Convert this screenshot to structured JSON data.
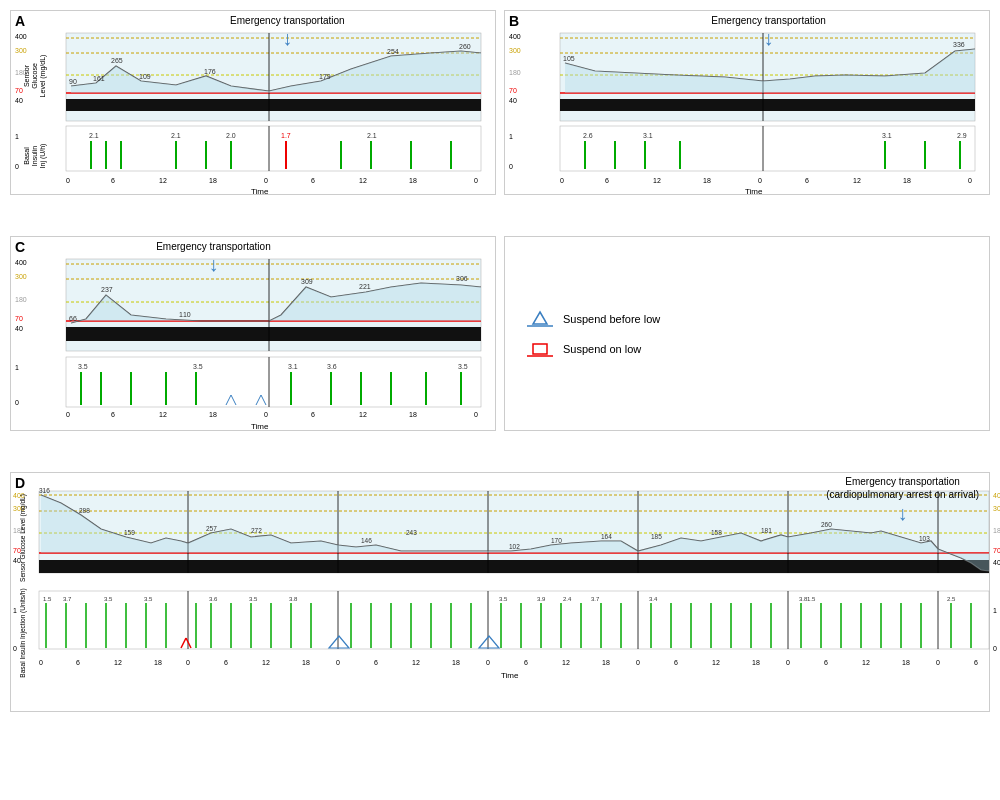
{
  "panels": {
    "A": {
      "label": "A",
      "emergency_label": "Emergency transportation",
      "y_glucose_labels": [
        "400",
        "300",
        "180",
        "70",
        "40"
      ],
      "y_insulin_labels": [
        "1",
        "0"
      ],
      "x_labels": [
        "0",
        "6",
        "12",
        "18",
        "0",
        "6",
        "12",
        "18",
        "0"
      ],
      "glucose_values": [
        "90",
        "161",
        "265",
        "109",
        "176",
        "179",
        "254",
        "260"
      ],
      "insulin_values": [
        "2.1",
        "2.1",
        "2.0",
        "1.7",
        "2.1"
      ]
    },
    "B": {
      "label": "B",
      "emergency_label": "Emergency transportation",
      "y_glucose_labels": [
        "400",
        "300",
        "180",
        "70",
        "40"
      ],
      "y_insulin_labels": [
        "1",
        "0"
      ],
      "x_labels": [
        "0",
        "6",
        "12",
        "18",
        "0",
        "6",
        "12",
        "18",
        "0"
      ],
      "glucose_values": [
        "105",
        "",
        "",
        "",
        "",
        "",
        "",
        "336"
      ],
      "insulin_values": [
        "2.6",
        "3.1",
        "3.1",
        "2.9"
      ]
    },
    "C": {
      "label": "C",
      "emergency_label": "Emergency transportation",
      "y_glucose_labels": [
        "400",
        "300",
        "180",
        "70",
        "40"
      ],
      "y_insulin_labels": [
        "1",
        "0"
      ],
      "x_labels": [
        "0",
        "6",
        "12",
        "18",
        "0",
        "6",
        "12",
        "18",
        "0"
      ],
      "glucose_values": [
        "66",
        "237",
        "309",
        "110",
        "221",
        "306"
      ],
      "insulin_values": [
        "3.5",
        "3.5",
        "3.1",
        "3.6",
        "3.5"
      ]
    },
    "D": {
      "label": "D",
      "emergency_label": "Emergency transportation\n(cardiopulmonary arrest on arrival)",
      "y_glucose_labels": [
        "400",
        "300",
        "180",
        "70",
        "40"
      ],
      "y_insulin_labels": [
        "1",
        "0"
      ],
      "x_labels": [
        "0",
        "6",
        "12",
        "18",
        "0",
        "6",
        "12",
        "18",
        "0",
        "6",
        "12",
        "18",
        "0",
        "6",
        "12",
        "18",
        "0",
        "6"
      ],
      "glucose_values": [
        "316",
        "288",
        "159",
        "257",
        "272",
        "146",
        "243",
        "102",
        "170",
        "164",
        "185",
        "158",
        "181",
        "260",
        "103"
      ],
      "insulin_values": [
        "1.5",
        "3.7",
        "3.5",
        "3.5",
        "3.6",
        "3.5",
        "3.8",
        "3.5",
        "3.9",
        "2.4",
        "3.7",
        "3.4",
        "3.8",
        "2.5",
        "1.5"
      ]
    }
  },
  "legend": {
    "suspend_before_low": "Suspend before low",
    "suspend_on_low": "Suspend on low"
  },
  "axes": {
    "time_label": "Time",
    "glucose_axis_label": "Sensor\nGlucose\nLevel (mg/dL)",
    "insulin_axis_label": "Basal\nInsulin\nInjection (Units/h)"
  }
}
